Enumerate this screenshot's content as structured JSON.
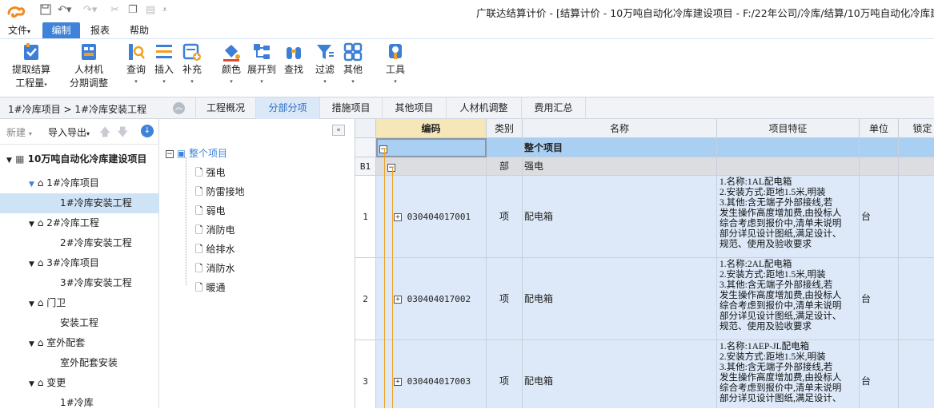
{
  "window": {
    "title": "广联达结算计价 - [结算计价 - 10万吨自动化冷库建设项目 - F:/22年公司/冷库/结算/10万吨自动化冷库建设项"
  },
  "menu": {
    "file": "文件",
    "edit": "编制",
    "report": "报表",
    "help": "帮助"
  },
  "ribbon": {
    "extract": [
      "提取结算",
      "工程量"
    ],
    "material": [
      "人材机",
      "分期调整"
    ],
    "query": "查询",
    "insert": "插入",
    "supplement": "补充",
    "color": "颜色",
    "expand": "展开到",
    "find": "查找",
    "filter": "过滤",
    "other": "其他",
    "tools": "工具"
  },
  "breadcrumb": "1#冷库项目 > 1#冷库安装工程",
  "tabs": [
    "工程概况",
    "分部分项",
    "措施项目",
    "其他项目",
    "人材机调整",
    "费用汇总"
  ],
  "left_toolbar": {
    "new": "新建",
    "import_export": "导入导出"
  },
  "project_tree": {
    "root": "10万吨自动化冷库建设项目",
    "nodes": [
      "1#冷库项目",
      "1#冷库安装工程",
      "2#冷库工程",
      "2#冷库安装工程",
      "3#冷库项目",
      "3#冷库安装工程",
      "门卫",
      "安装工程",
      "室外配套",
      "室外配套安装",
      "变更",
      "1#冷库"
    ]
  },
  "division_tree": {
    "root": "整个项目",
    "children": [
      "强电",
      "防雷接地",
      "弱电",
      "消防电",
      "给排水",
      "消防水",
      "暖通"
    ]
  },
  "grid": {
    "headers": [
      "编码",
      "类别",
      "名称",
      "项目特征",
      "单位",
      "锁定"
    ],
    "whole_row": "整个项目",
    "section_row": {
      "no": "B1",
      "type": "部",
      "name": "强电"
    },
    "rows": [
      {
        "no": "1",
        "code": "030404017001",
        "type": "项",
        "name": "配电箱",
        "features": "1.名称:1AL配电箱\n2.安装方式:距地1.5米,明装\n3.其他:含无端子外部接线,若\n发生操作高度增加费,由投标人\n综合考虑到报价中,清单未说明\n部分详见设计图纸,满足设计、\n规范、使用及验收要求",
        "unit": "台"
      },
      {
        "no": "2",
        "code": "030404017002",
        "type": "项",
        "name": "配电箱",
        "features": "1.名称:2AL配电箱\n2.安装方式:距地1.5米,明装\n3.其他:含无端子外部接线,若\n发生操作高度增加费,由投标人\n综合考虑到报价中,清单未说明\n部分详见设计图纸,满足设计、\n规范、使用及验收要求",
        "unit": "台"
      },
      {
        "no": "3",
        "code": "030404017003",
        "type": "项",
        "name": "配电箱",
        "features": "1.名称:1AEP-JL配电箱\n2.安装方式:距地1.5米,明装\n3.其他:含无端子外部接线,若\n发生操作高度增加费,由投标人\n综合考虑到报价中,清单未说明\n部分详见设计图纸,满足设计、",
        "unit": "台"
      }
    ]
  },
  "colors": {
    "accent": "#3f83d8",
    "selected_row": "#cfe3f7",
    "row_bg": "#dde9f8",
    "whole_row": "#a9cff2"
  }
}
